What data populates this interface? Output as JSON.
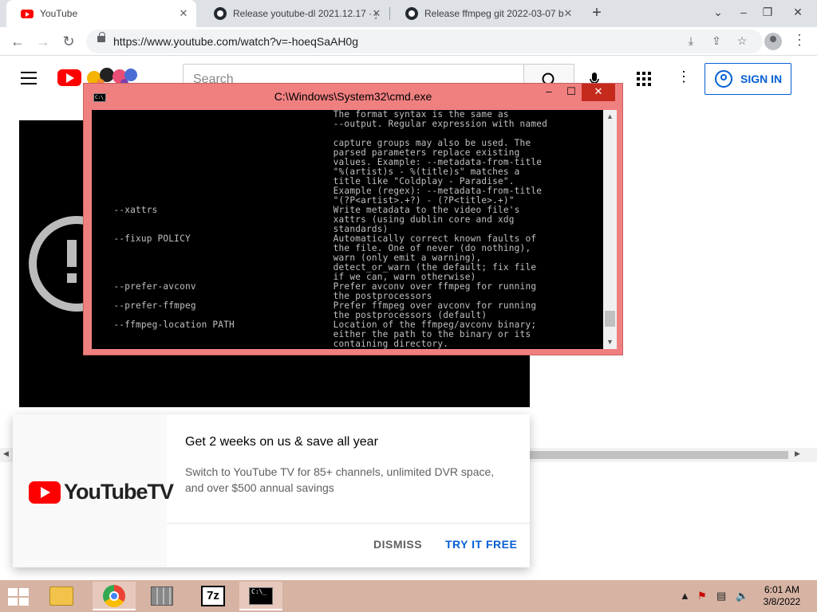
{
  "browser": {
    "tabs": [
      {
        "title": "YouTube",
        "icon": "youtube-favicon",
        "active": true
      },
      {
        "title": "Release youtube-dl 2021.12.17 · y",
        "icon": "github-favicon",
        "active": false
      },
      {
        "title": "Release ffmpeg git 2022-03-07 b",
        "icon": "github-favicon",
        "active": false
      }
    ],
    "new_tab": "+",
    "url": "https://www.youtube.com/watch?v=-hoeqSaAH0g"
  },
  "youtube": {
    "search_placeholder": "Search",
    "sign_in_label": "SIGN IN"
  },
  "promo": {
    "logo_text": "YouTubeTV",
    "title": "Get 2 weeks on us & save all year",
    "body": "Switch to YouTube TV for 85+ channels, unlimited DVR space, and over $500 annual savings",
    "dismiss_label": "DISMISS",
    "try_label": "TRY IT FREE",
    "accent": "#065fd4",
    "dismiss_color": "#606060"
  },
  "cmd": {
    "title": "C:\\Windows\\System32\\cmd.exe",
    "icon_text": "C:\\_",
    "lines": [
      "                                            The format syntax is the same as",
      "                                            --output. Regular expression with named",
      "",
      "                                            capture groups may also be used. The",
      "                                            parsed parameters replace existing",
      "                                            values. Example: --metadata-from-title",
      "                                            \"%(artist)s - %(title)s\" matches a",
      "                                            title like \"Coldplay - Paradise\".",
      "                                            Example (regex): --metadata-from-title",
      "                                            \"(?P<artist>.+?) - (?P<title>.+)\"",
      "    --xattrs                                Write metadata to the video file's",
      "                                            xattrs (using dublin core and xdg",
      "                                            standards)",
      "    --fixup POLICY                          Automatically correct known faults of",
      "                                            the file. One of never (do nothing),",
      "                                            warn (only emit a warning),",
      "                                            detect_or_warn (the default; fix file",
      "                                            if we can, warn otherwise)",
      "    --prefer-avconv                         Prefer avconv over ffmpeg for running",
      "                                            the postprocessors",
      "    --prefer-ffmpeg                         Prefer ffmpeg over avconv for running",
      "                                            the postprocessors (default)",
      "    --ffmpeg-location PATH                  Location of the ffmpeg/avconv binary;",
      "                                            either the path to the binary or its",
      "                                            containing directory."
    ]
  },
  "taskbar": {
    "items": [
      "file-explorer",
      "chrome",
      "app-cube",
      "7-zip",
      "cmd"
    ],
    "sevenzip_label": "7z",
    "cmd_label": "C:\\_",
    "time": "6:01 AM",
    "date": "3/8/2022"
  }
}
